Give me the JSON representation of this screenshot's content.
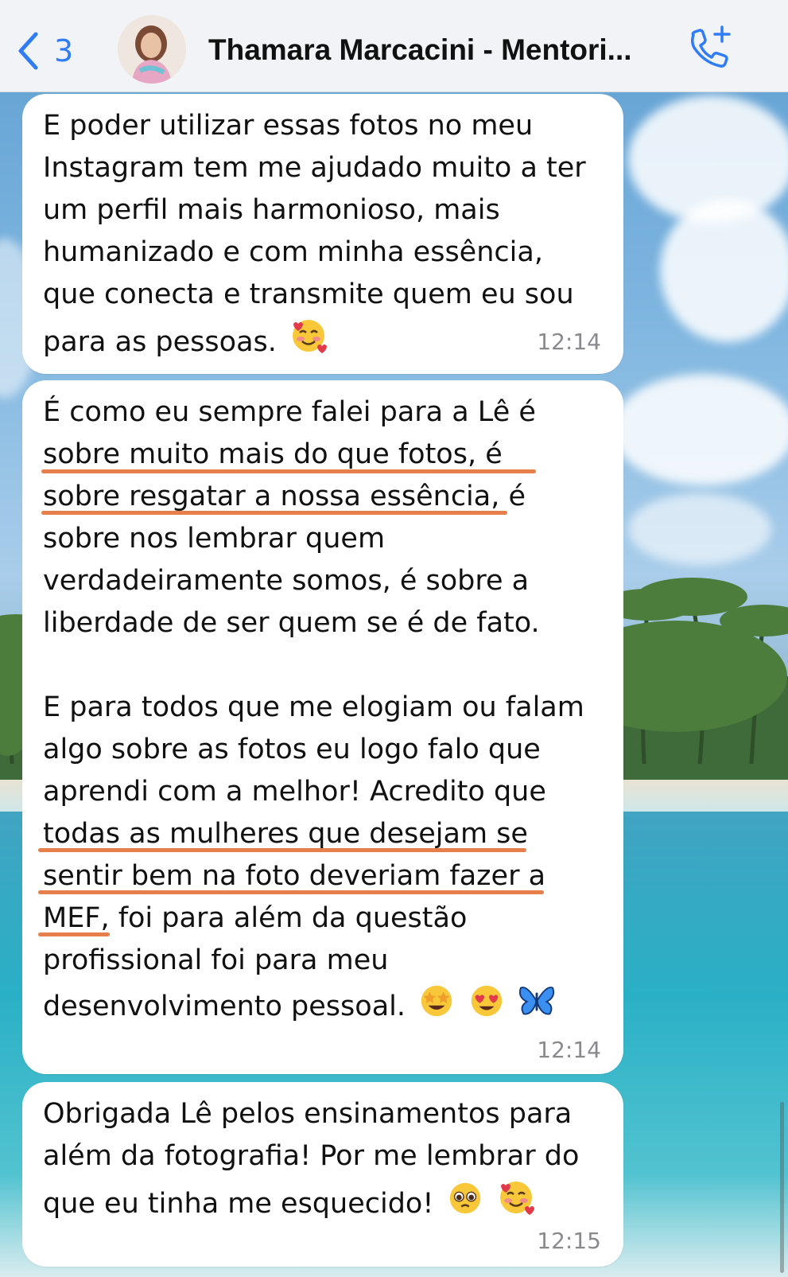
{
  "header": {
    "back_count": "3",
    "contact_name": "Thamara Marcacini - Mentori..."
  },
  "messages": [
    {
      "lines": [
        "E poder utilizar essas fotos no meu",
        "Instagram tem me ajudado muito a ter",
        "um perfil mais harmonioso, mais",
        "humanizado e com minha essência,",
        "que conecta e transmite quem eu sou",
        "para as pessoas."
      ],
      "time": "12:14"
    },
    {
      "lines": [
        "É como eu sempre falei para a Lê é",
        "sobre muito mais do que fotos, é",
        "sobre resgatar a nossa essência, é",
        "sobre nos lembrar quem",
        "verdadeiramente somos, é sobre a",
        "liberdade de ser quem se é de fato.",
        "",
        "E para todos que me elogiam ou falam",
        "algo sobre as fotos eu logo falo que",
        "aprendi com a melhor! Acredito que",
        "todas as mulheres que desejam se",
        "sentir bem na foto deveriam fazer a",
        "MEF, foi para além da questão",
        "profissional foi para meu",
        "desenvolvimento pessoal."
      ],
      "time": "12:14"
    },
    {
      "lines": [
        "Obrigada Lê pelos ensinamentos para",
        "além da fotografia! Por me lembrar do",
        "que eu tinha me esquecido!"
      ],
      "time": "12:15"
    }
  ],
  "icons": {
    "back": "chevron-left-icon",
    "call": "phone-plus-icon",
    "emoji_1": "smiling-face-with-hearts",
    "emoji_2": "star-struck",
    "emoji_3": "heart-eyes",
    "emoji_4": "butterfly",
    "emoji_5": "pleading-face"
  },
  "colors": {
    "accent": "#2f7cf6",
    "underline": "#e67f4b",
    "bubble": "#ffffff",
    "timestamp": "#8a8a8e"
  }
}
